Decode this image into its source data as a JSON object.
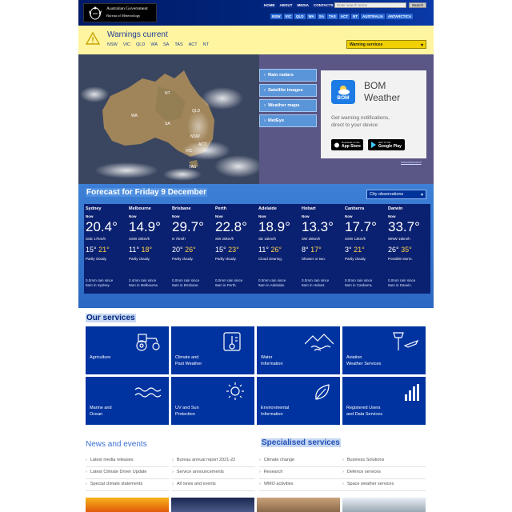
{
  "header": {
    "gov_line1": "Australian Government",
    "gov_line2": "Bureau of Meteorology",
    "top_links": [
      "HOME",
      "ABOUT",
      "MEDIA",
      "CONTACTS"
    ],
    "search_placeholder": "Enter search terms",
    "search_button": "Search",
    "state_links": [
      "NSW",
      "VIC",
      "QLD",
      "WA",
      "SA",
      "TAS",
      "ACT",
      "NT",
      "AUSTRALIA",
      "ANTARCTICA"
    ]
  },
  "warnings": {
    "title": "Warnings current",
    "states": [
      "NSW",
      "VIC",
      "QLD",
      "WA",
      "SA",
      "TAS",
      "ACT",
      "NT"
    ],
    "services_select": "Warning services"
  },
  "map": {
    "labels": [
      "NT",
      "QLD",
      "WA",
      "SA",
      "NSW",
      "ACT",
      "VIC",
      "TAS"
    ],
    "links": [
      "Rain radars",
      "Satellite images",
      "Weather maps",
      "MetEye"
    ]
  },
  "ad": {
    "logo_text": "BOM",
    "title_line1": "BOM",
    "title_line2": "Weather",
    "desc_line1": "Get warning notifications,",
    "desc_line2": "direct to your device",
    "appstore_small": "Download on the",
    "appstore_big": "App Store",
    "gplay_small": "GET IT ON",
    "gplay_big": "Google Play",
    "note": "Advertisement"
  },
  "forecast": {
    "title": "Forecast for Friday 9 December",
    "select": "City observations",
    "cities": [
      {
        "name": "Sydney",
        "now": "Now",
        "temp": "20.4°",
        "wind": "SSE 17km/h",
        "min": "15°",
        "max": "21°",
        "desc": "Partly cloudy.",
        "rain1": "0.0mm rain since",
        "rain2": "9am in Sydney."
      },
      {
        "name": "Melbourne",
        "now": "Now",
        "temp": "14.9°",
        "wind": "SSW 20km/h",
        "min": "11°",
        "max": "18°",
        "desc": "Partly cloudy.",
        "rain1": "2.4mm rain since",
        "rain2": "9am in Melbourne."
      },
      {
        "name": "Brisbane",
        "now": "Now",
        "temp": "29.7°",
        "wind": "N 7km/h",
        "min": "20°",
        "max": "26°",
        "desc": "Partly cloudy.",
        "rain1": "0.0mm rain since",
        "rain2": "9am in Brisbane."
      },
      {
        "name": "Perth",
        "now": "Now",
        "temp": "22.8°",
        "wind": "SW 20km/h",
        "min": "15°",
        "max": "23°",
        "desc": "Partly cloudy.",
        "rain1": "0.0mm rain since",
        "rain2": "9am in Perth."
      },
      {
        "name": "Adelaide",
        "now": "Now",
        "temp": "18.9°",
        "wind": "SE 15km/h",
        "min": "11°",
        "max": "26°",
        "desc": "Cloud clearing.",
        "rain1": "0.0mm rain since",
        "rain2": "9am in Adelaide."
      },
      {
        "name": "Hobart",
        "now": "Now",
        "temp": "13.3°",
        "wind": "SW 26km/h",
        "min": "8°",
        "max": "17°",
        "desc": "Shower or two.",
        "rain1": "0.0mm rain since",
        "rain2": "9am in Hobart."
      },
      {
        "name": "Canberra",
        "now": "Now",
        "temp": "17.7°",
        "wind": "SSW 13km/h",
        "min": "3°",
        "max": "21°",
        "desc": "Partly cloudy.",
        "rain1": "0.0mm rain since",
        "rain2": "9am in Canberra."
      },
      {
        "name": "Darwin",
        "now": "Now",
        "temp": "33.7°",
        "wind": "WNW 15km/h",
        "min": "26°",
        "max": "35°",
        "desc": "Possible storm.",
        "rain1": "0.0mm rain since",
        "rain2": "9am in Darwin."
      }
    ]
  },
  "services": {
    "title": "Our services",
    "tiles": [
      {
        "l1": "Agriculture",
        "l2": "",
        "icon": "tractor-icon"
      },
      {
        "l1": "Climate and",
        "l2": "Past Weather",
        "icon": "thermometer-icon"
      },
      {
        "l1": "Water",
        "l2": "Information",
        "icon": "mountain-water-icon"
      },
      {
        "l1": "Aviation",
        "l2": "Weather Services",
        "icon": "aviation-icon"
      },
      {
        "l1": "Marine and",
        "l2": "Ocean",
        "icon": "waves-icon"
      },
      {
        "l1": "UV and Sun",
        "l2": "Protection",
        "icon": "sun-icon"
      },
      {
        "l1": "Environmental",
        "l2": "Information",
        "icon": "leaf-icon"
      },
      {
        "l1": "Registered Users",
        "l2": "and Data Services",
        "icon": "bar-chart-icon"
      }
    ]
  },
  "news": {
    "title": "News and events",
    "col1": [
      "Latest media releases",
      "Latest Climate Driver Update",
      "Special climate statements"
    ],
    "col2": [
      "Bureau annual report 2021-22",
      "Service announcements",
      "All news and events"
    ]
  },
  "specialised": {
    "title": "Specialised services",
    "col1": [
      "Climate change",
      "Research",
      "WMO activities"
    ],
    "col2": [
      "Business Solutions",
      "Defence services",
      "Space weather services"
    ]
  }
}
